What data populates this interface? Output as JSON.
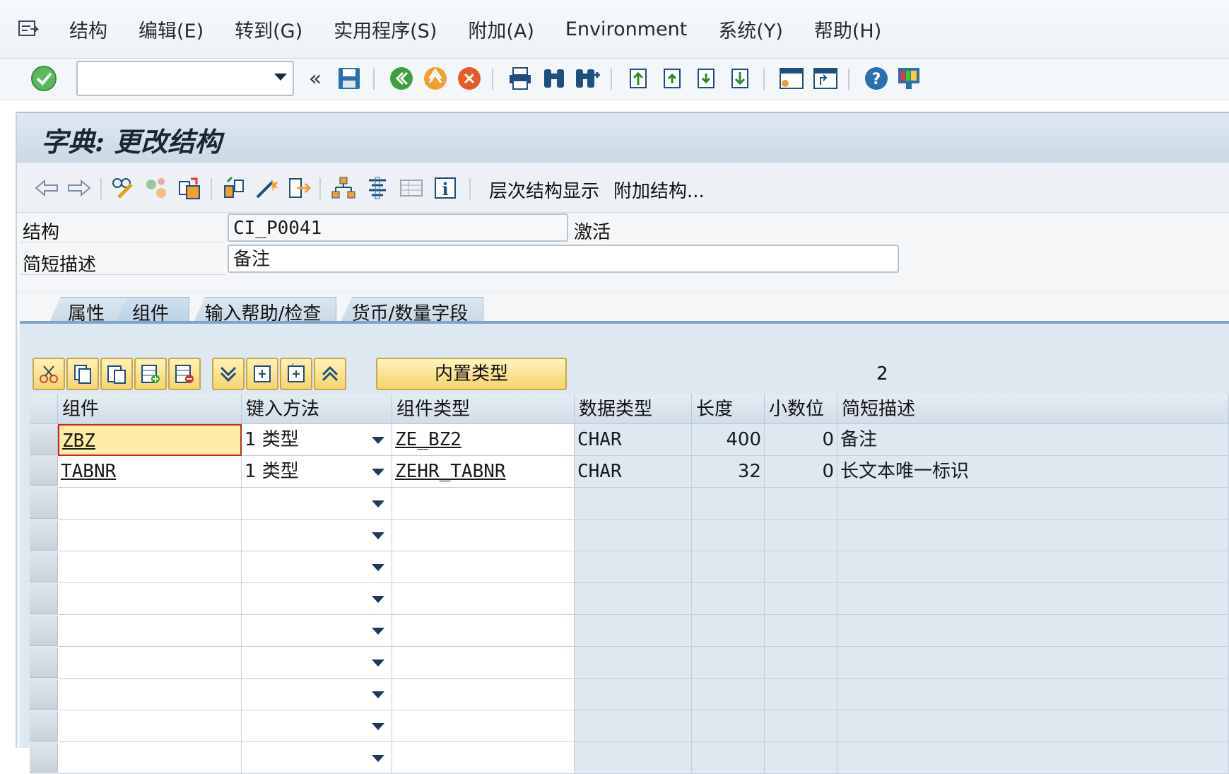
{
  "menu": {
    "items": [
      "结构",
      "编辑(E)",
      "转到(G)",
      "实用程序(S)",
      "附加(A)",
      "Environment",
      "系统(Y)",
      "帮助(H)"
    ]
  },
  "toolbar": {
    "command_value": "",
    "icons": [
      "enter-check-icon",
      "back-icon",
      "save-icon",
      "green-back-icon",
      "exit-icon",
      "cancel-icon",
      "print-icon",
      "find-icon",
      "find-next-icon",
      "first-page-icon",
      "previous-page-icon",
      "next-page-icon",
      "last-page-icon",
      "create-session-icon",
      "shortcut-icon",
      "help-icon",
      "customize-layout-icon"
    ]
  },
  "screen": {
    "title": "字典: 更改结构"
  },
  "app_toolbar": {
    "hierarchy_label": "层次结构显示",
    "append_label": "附加结构..."
  },
  "header": {
    "structure_label": "结构",
    "structure_value": "CI_P0041",
    "status": "激活",
    "description_label": "简短描述",
    "description_value": "备注"
  },
  "tabs": [
    {
      "label": "属性"
    },
    {
      "label": "组件"
    },
    {
      "label": "输入帮助/检查"
    },
    {
      "label": "货币/数量字段"
    }
  ],
  "table_controls": {
    "builtin_type_label": "内置类型",
    "row_count": "2"
  },
  "columns": [
    "组件",
    "键入方法",
    "组件类型",
    "数据类型",
    "长度",
    "小数位",
    "简短描述"
  ],
  "rows": [
    {
      "component": "ZBZ",
      "typing": "1 类型",
      "comp_type": "ZE_BZ2",
      "data_type": "CHAR",
      "length": "400",
      "decimals": "0",
      "desc": "备注"
    },
    {
      "component": "TABNR",
      "typing": "1 类型",
      "comp_type": "ZEHR_TABNR",
      "data_type": "CHAR",
      "length": "32",
      "decimals": "0",
      "desc": "长文本唯一标识"
    }
  ]
}
